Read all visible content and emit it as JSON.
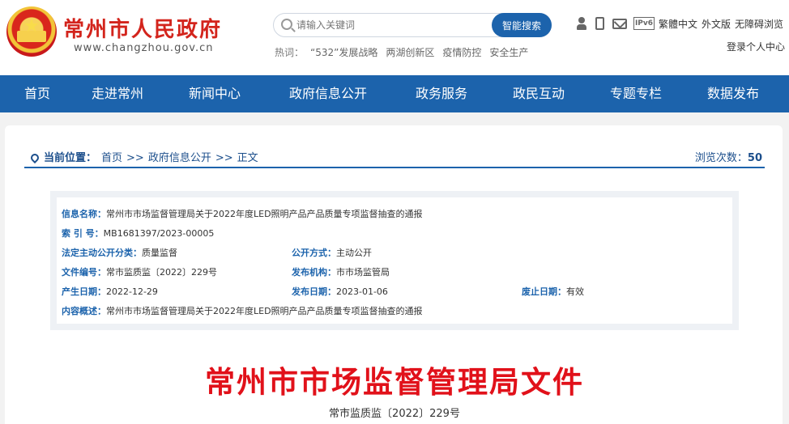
{
  "header": {
    "site_title": "常州市人民政府",
    "site_url": "www.changzhou.gov.cn",
    "search": {
      "placeholder": "请输入关键词",
      "button": "智能搜索"
    },
    "hot": {
      "label": "热词：",
      "items": [
        "“532”发展战略",
        "两湖创新区",
        "疫情防控",
        "安全生产"
      ]
    },
    "icons": [
      "person-icon",
      "phone-icon",
      "mail-icon",
      "ipv6-icon"
    ],
    "ipv6_text": "IPv6",
    "links": [
      "繁體中文",
      "外文版",
      "无障碍浏览"
    ],
    "login": "登录个人中心"
  },
  "nav": [
    "首页",
    "走进常州",
    "新闻中心",
    "政府信息公开",
    "政务服务",
    "政民互动",
    "专题专栏",
    "数据发布"
  ],
  "breadcrumb": {
    "label": "当前位置：",
    "items": [
      "首页",
      "政府信息公开",
      "正文"
    ],
    "sep": ">>",
    "views_label": "浏览次数：",
    "views": "50"
  },
  "meta": {
    "info_name_label": "信息名称：",
    "info_name": "常州市市场监督管理局关于2022年度LED照明产品产品质量专项监督抽查的通报",
    "index_label": "索 引 号：",
    "index": "MB1681397/2023-00005",
    "category_label": "法定主动公开分类：",
    "category": "质量监督",
    "method_label": "公开方式：",
    "method": "主动公开",
    "doc_no_label": "文件编号：",
    "doc_no": "常市监质监〔2022〕229号",
    "org_label": "发布机构：",
    "org": "市市场监管局",
    "created_label": "产生日期：",
    "created": "2022-12-29",
    "published_label": "发布日期：",
    "published": "2023-01-06",
    "expiry_label": "废止日期：",
    "expiry": "有效",
    "summary_label": "内容概述：",
    "summary": "常州市市场监督管理局关于2022年度LED照明产品产品质量专项监督抽查的通报"
  },
  "document": {
    "title": "常州市市场监督管理局文件",
    "number": "常市监质监〔2022〕229号"
  }
}
